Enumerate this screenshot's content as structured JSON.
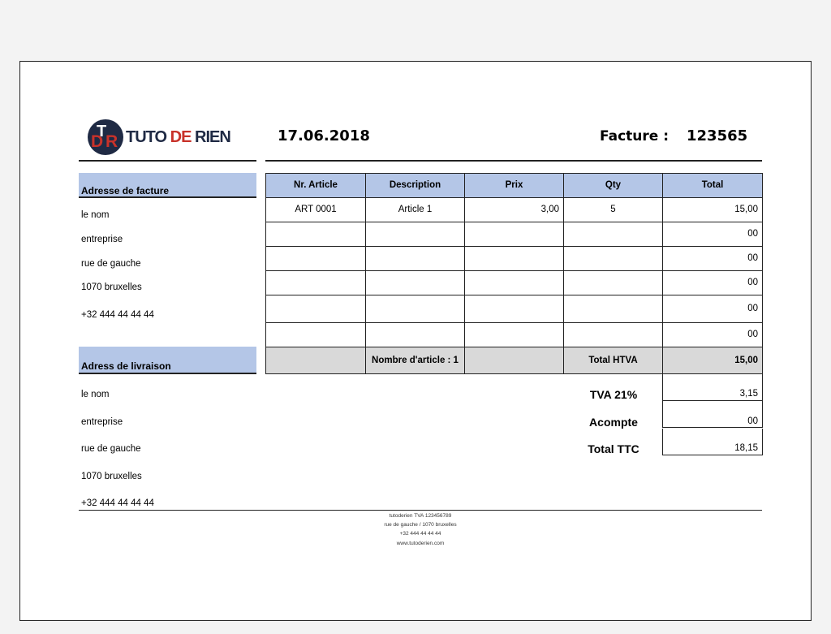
{
  "logo": {
    "text_tuto": "TUTO",
    "text_de": "DE",
    "text_rien": "RIEN"
  },
  "header": {
    "date": "17.06.2018",
    "facture_label": "Facture :",
    "facture_number": "123565"
  },
  "billing": {
    "title": "Adresse de facture",
    "name": "le nom",
    "company": "entreprise",
    "street": "rue de gauche",
    "city": "1070 bruxelles",
    "phone": "+32 444 44 44 44"
  },
  "delivery": {
    "title": "Adress de livraison",
    "name": "le nom",
    "company": "entreprise",
    "street": "rue de gauche",
    "city": "1070 bruxelles",
    "phone": "+32 444 44 44 44"
  },
  "table": {
    "columns": [
      "Nr. Article",
      "Description",
      "Prix",
      "Qty",
      "Total"
    ],
    "rows": [
      [
        "ART 0001",
        "Article 1",
        "3,00",
        "5",
        "15,00"
      ],
      [
        "",
        "",
        "",
        "",
        "00"
      ],
      [
        "",
        "",
        "",
        "",
        "00"
      ],
      [
        "",
        "",
        "",
        "",
        "00"
      ],
      [
        "",
        "",
        "",
        "",
        "00"
      ],
      [
        "",
        "",
        "",
        "",
        "00"
      ]
    ],
    "article_count_label": "Nombre d'article : 1",
    "total_htva_label": "Total HTVA",
    "total_htva_value": "15,00"
  },
  "summary": {
    "tva_label": "TVA 21%",
    "tva_value": "3,15",
    "acompte_label": "Acompte",
    "acompte_value": "00",
    "ttc_label": "Total TTC",
    "ttc_value": "18,15"
  },
  "footer": {
    "line1": "tutoderien  TVA 123456789",
    "line2": "rue de gauche / 1070 bruxelles",
    "line3": "+32 444 44 44 44",
    "line4": "www.tutoderien.com"
  },
  "colors": {
    "header_fill": "#b4c6e7",
    "footer_fill": "#d9d9d9",
    "logo_navy": "#1f2a44",
    "logo_red": "#c8322a"
  }
}
